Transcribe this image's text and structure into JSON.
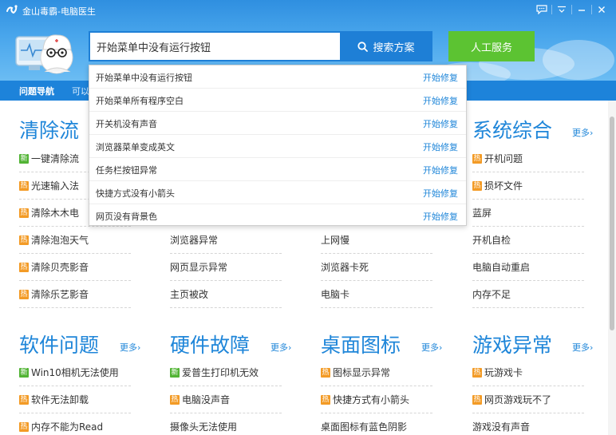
{
  "window": {
    "title": "金山毒霸-电脑医生"
  },
  "search": {
    "value": "开始菜单中没有运行按钮",
    "button_label": "搜索方案",
    "manual_label": "人工服务"
  },
  "nav": {
    "label": "问题导航",
    "rest": "可以"
  },
  "dropdown": {
    "fix_label": "开始修复",
    "items": [
      "开始菜单中没有运行按钮",
      "开始菜单所有程序空白",
      "开关机没有声音",
      "浏览器菜单变成英文",
      "任务栏按钮异常",
      "快捷方式没有小箭头",
      "网页没有背景色"
    ]
  },
  "colors": {
    "brand_blue": "#1f86d9",
    "hot_badge": "#f39b26",
    "new_badge": "#52b435",
    "manual_green": "#5cc332"
  },
  "sections": [
    {
      "title": "清除流",
      "more": "",
      "items": [
        {
          "text": "一键清除流",
          "badge": "新"
        },
        {
          "text": "光速输入法",
          "badge": "热"
        },
        {
          "text": "清除木木电",
          "badge": "热"
        },
        {
          "text": "清除泡泡天气",
          "badge": "热"
        },
        {
          "text": "清除贝壳影音",
          "badge": "热"
        },
        {
          "text": "清除乐艺影音",
          "badge": "热"
        }
      ]
    },
    {
      "title": "",
      "more": "",
      "items": [
        {
          "text": "",
          "badge": ""
        },
        {
          "text": "",
          "badge": ""
        },
        {
          "text": "",
          "badge": ""
        },
        {
          "text": "浏览器异常",
          "badge": ""
        },
        {
          "text": "网页显示异常",
          "badge": ""
        },
        {
          "text": "主页被改",
          "badge": ""
        }
      ]
    },
    {
      "title": "",
      "more": "",
      "items": [
        {
          "text": "",
          "badge": ""
        },
        {
          "text": "",
          "badge": ""
        },
        {
          "text": "",
          "badge": ""
        },
        {
          "text": "上网慢",
          "badge": ""
        },
        {
          "text": "浏览器卡死",
          "badge": ""
        },
        {
          "text": "电脑卡",
          "badge": ""
        }
      ]
    },
    {
      "title": "系统综合",
      "more": "更多›",
      "items": [
        {
          "text": "开机问题",
          "badge": "热"
        },
        {
          "text": "损坏文件",
          "badge": "热"
        },
        {
          "text": "蓝屏",
          "badge": ""
        },
        {
          "text": "开机自检",
          "badge": ""
        },
        {
          "text": "电脑自动重启",
          "badge": ""
        },
        {
          "text": "内存不足",
          "badge": ""
        }
      ]
    },
    {
      "title": "软件问题",
      "more": "更多›",
      "items": [
        {
          "text": "Win10相机无法使用",
          "badge": "新"
        },
        {
          "text": "软件无法卸载",
          "badge": "热"
        },
        {
          "text": "内存不能为Read",
          "badge": "热"
        }
      ]
    },
    {
      "title": "硬件故障",
      "more": "更多›",
      "items": [
        {
          "text": "爱普生打印机无效",
          "badge": "新"
        },
        {
          "text": "电脑没声音",
          "badge": "热"
        },
        {
          "text": "摄像头无法使用",
          "badge": ""
        }
      ]
    },
    {
      "title": "桌面图标",
      "more": "更多›",
      "items": [
        {
          "text": "图标显示异常",
          "badge": "热"
        },
        {
          "text": "快捷方式有小箭头",
          "badge": "热"
        },
        {
          "text": "桌面图标有蓝色阴影",
          "badge": ""
        }
      ]
    },
    {
      "title": "游戏异常",
      "more": "更多›",
      "items": [
        {
          "text": "玩游戏卡",
          "badge": "热"
        },
        {
          "text": "网页游戏玩不了",
          "badge": "热"
        },
        {
          "text": "游戏没有声音",
          "badge": ""
        }
      ]
    }
  ]
}
